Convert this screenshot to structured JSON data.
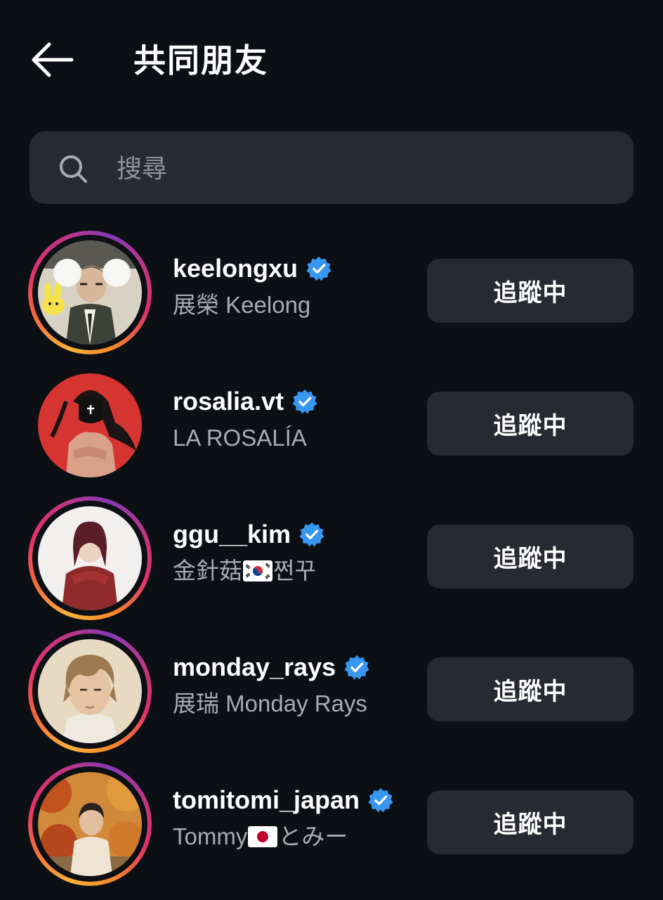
{
  "header": {
    "title": "共同朋友",
    "back_icon": "arrow-left-icon"
  },
  "search": {
    "placeholder": "搜尋",
    "value": "",
    "icon": "search-icon"
  },
  "colors": {
    "background": "#0c0f14",
    "surface": "#272a31",
    "secondary_text": "#a7abb3",
    "verified_blue": "#3897f0"
  },
  "users": [
    {
      "username": "keelongxu",
      "verified": true,
      "fullname": "展榮 Keelong",
      "button_label": "追蹤中",
      "story_ring": true
    },
    {
      "username": "rosalia.vt",
      "verified": true,
      "fullname": "LA ROSALÍA",
      "button_label": "追蹤中",
      "story_ring": false
    },
    {
      "username": "ggu__kim",
      "verified": true,
      "fullname_parts": [
        "金針菇",
        "🇰🇷",
        "쩐꾸"
      ],
      "button_label": "追蹤中",
      "story_ring": true
    },
    {
      "username": "monday_rays",
      "verified": true,
      "fullname": "展瑞 Monday Rays",
      "button_label": "追蹤中",
      "story_ring": true
    },
    {
      "username": "tomitomi_japan",
      "verified": true,
      "fullname_parts": [
        "Tommy",
        "🇯🇵",
        "とみー"
      ],
      "button_label": "追蹤中",
      "story_ring": true
    }
  ]
}
